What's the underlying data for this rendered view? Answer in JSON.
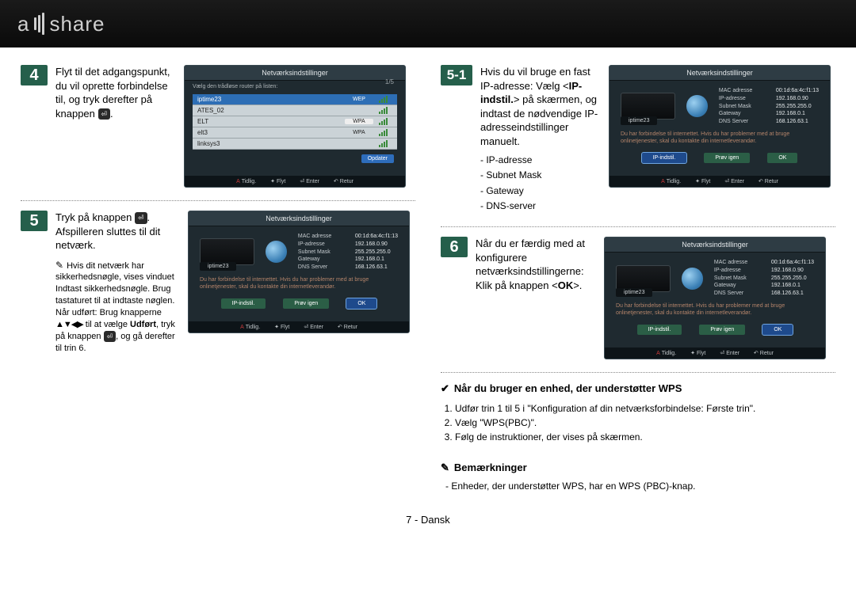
{
  "brand": {
    "left": "a",
    "right": "share"
  },
  "footer_page": "7 - Dansk",
  "screens": {
    "title": "Netværksindstillinger",
    "list_sub": "Vælg den trådløse router på listen:",
    "page_count": "1/5",
    "routers": [
      {
        "name": "iptime23",
        "sec": "WEP"
      },
      {
        "name": "ATES_02",
        "sec": ""
      },
      {
        "name": "ELT",
        "sec": "WPA"
      },
      {
        "name": "elt3",
        "sec": "WPA"
      },
      {
        "name": "linksys3",
        "sec": ""
      }
    ],
    "update": "Opdater",
    "navbar": {
      "back": "Tidlig.",
      "move": "Flyt",
      "enter": "Enter",
      "ret": "Retur"
    },
    "ssid": "iptime23",
    "net": {
      "mac_l": "MAC adresse",
      "mac_v": "00:1d:6a:4c:f1:13",
      "ip_l": "IP-adresse",
      "ip_v": "192.168.0.90",
      "sm_l": "Subnet Mask",
      "sm_v": "255.255.255.0",
      "gw_l": "Gateway",
      "gw_v": "192.168.0.1",
      "dns_l": "DNS Server",
      "dns_v": "168.126.63.1"
    },
    "net6": {
      "ip_v": "192.168.0.90",
      "sm_v": "255.255.255.0",
      "gw_v": "192.168.0.1",
      "dns_v": "168.126.63.1"
    },
    "msg": "Du har forbindelse til internettet. Hvis du har problemer med at bruge onlinetjenester, skal du kontakte din internetleverandør.",
    "btn_ip": "IP-indstil.",
    "btn_retry": "Prøv igen",
    "btn_ok": "OK"
  },
  "step4": {
    "num": "4",
    "text_a": "Flyt til det adgangspunkt, du vil oprette forbindelse til, og tryk derefter på knappen ",
    "text_b": "."
  },
  "step5": {
    "num": "5",
    "text_a": "Tryk på knappen ",
    "text_b": ". Afspilleren sluttes til dit netværk.",
    "note": "Hvis dit netværk har sikkerhedsnøgle, vises vinduet Indtast sikkerhedsnøgle. Brug tastaturet til at indtaste nøglen. Når udført: Brug knapperne ",
    "note_b": " til at vælge ",
    "udfort": "Udført",
    "note_c": ", tryk på knappen ",
    "note_d": ", og gå derefter til trin 6."
  },
  "step5_1": {
    "num": "5-1",
    "text_a": "Hvis du vil bruge en fast IP-adresse: Vælg <",
    "bold": "IP-indstil.",
    "text_b": "> på skærmen, og indtast de nødvendige IP-adresseindstillinger manuelt.",
    "items": [
      "IP-adresse",
      "Subnet Mask",
      "Gateway",
      "DNS-server"
    ]
  },
  "step6": {
    "num": "6",
    "text_a": "Når du er færdig med at konfigurere netværksindstillingerne: Klik på knappen <",
    "bold": "OK",
    "text_b": ">."
  },
  "wps": {
    "heading": "Når du bruger en enhed, der understøtter WPS",
    "items": [
      "Udfør trin 1 til 5 i \"Konfiguration af din netværksforbindelse: Første trin\".",
      "Vælg \"WPS(PBC)\".",
      "Følg de instruktioner, der vises på skærmen."
    ]
  },
  "remarks": {
    "heading": "Bemærkninger",
    "item": "Enheder, der understøtter WPS, har en WPS (PBC)-knap."
  }
}
